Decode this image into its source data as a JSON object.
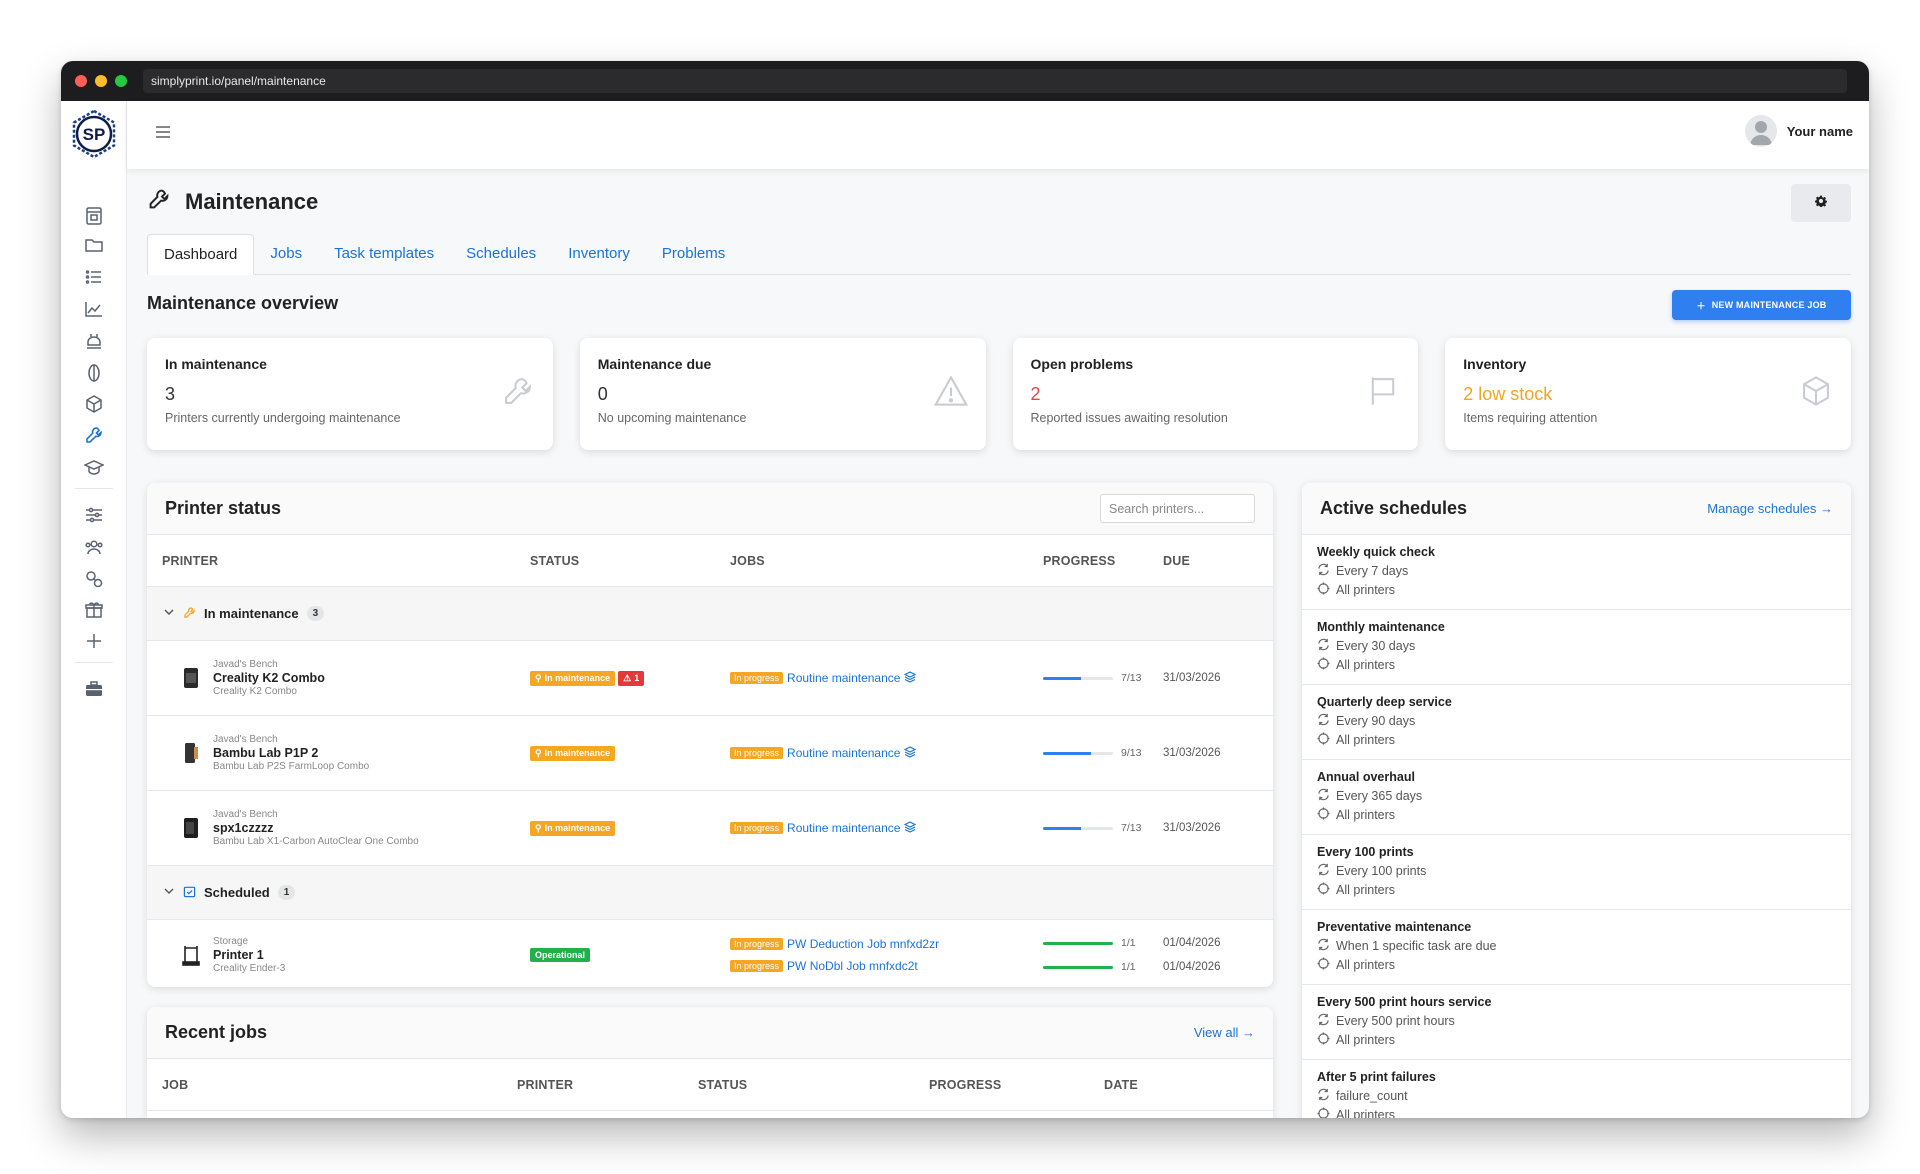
{
  "browser": {
    "url": "simplyprint.io/panel/maintenance"
  },
  "user": {
    "name": "Your name"
  },
  "page": {
    "title": "Maintenance",
    "tabs": [
      "Dashboard",
      "Jobs",
      "Task templates",
      "Schedules",
      "Inventory",
      "Problems"
    ],
    "overview_title": "Maintenance overview",
    "new_job_label": "NEW MAINTENANCE JOB"
  },
  "cards": [
    {
      "title": "In maintenance",
      "value": "3",
      "desc": "Printers currently undergoing maintenance",
      "icon": "wrench-icon"
    },
    {
      "title": "Maintenance due",
      "value": "0",
      "desc": "No upcoming maintenance",
      "icon": "warning-icon"
    },
    {
      "title": "Open problems",
      "value": "2",
      "desc": "Reported issues awaiting resolution",
      "icon": "flag-icon",
      "color": "#e0454b"
    },
    {
      "title": "Inventory",
      "value": "2 low stock",
      "desc": "Items requiring attention",
      "icon": "box-icon",
      "color": "#f0a524"
    }
  ],
  "printer_status": {
    "title": "Printer status",
    "search_placeholder": "Search printers...",
    "columns": [
      "PRINTER",
      "STATUS",
      "JOBS",
      "PROGRESS",
      "DUE"
    ],
    "groups": [
      {
        "label": "In maintenance",
        "count": "3",
        "rows": [
          {
            "location": "Javad's Bench",
            "name": "Creality K2 Combo",
            "model": "Creality K2 Combo",
            "status": "In maintenance",
            "problem_count": "1",
            "jobs": [
              {
                "state": "In progress",
                "name": "Routine maintenance",
                "progress": "7/13",
                "progress_frac": 0.54,
                "due": "31/03/2026"
              }
            ]
          },
          {
            "location": "Javad's Bench",
            "name": "Bambu Lab P1P 2",
            "model": "Bambu Lab P2S FarmLoop Combo",
            "status": "In maintenance",
            "jobs": [
              {
                "state": "In progress",
                "name": "Routine maintenance",
                "progress": "9/13",
                "progress_frac": 0.69,
                "due": "31/03/2026"
              }
            ]
          },
          {
            "location": "Javad's Bench",
            "name": "spx1czzzz",
            "model": "Bambu Lab X1-Carbon AutoClear One Combo",
            "status": "In maintenance",
            "jobs": [
              {
                "state": "In progress",
                "name": "Routine maintenance",
                "progress": "7/13",
                "progress_frac": 0.54,
                "due": "31/03/2026"
              }
            ]
          }
        ]
      },
      {
        "label": "Scheduled",
        "count": "1",
        "rows": [
          {
            "location": "Storage",
            "name": "Printer 1",
            "model": "Creality Ender-3",
            "status": "Operational",
            "jobs": [
              {
                "state": "In progress",
                "name": "PW Deduction Job mnfxd2zr",
                "progress": "1/1",
                "progress_frac": 1,
                "due": "01/04/2026"
              },
              {
                "state": "In progress",
                "name": "PW NoDbl Job mnfxdc2t",
                "progress": "1/1",
                "progress_frac": 1,
                "due": "01/04/2026"
              }
            ]
          }
        ]
      }
    ]
  },
  "recent_jobs": {
    "title": "Recent jobs",
    "view_all": "View all →",
    "columns": [
      "JOB",
      "PRINTER",
      "STATUS",
      "PROGRESS",
      "DATE"
    ]
  },
  "schedules": {
    "title": "Active schedules",
    "manage": "Manage schedules →",
    "items": [
      {
        "name": "Weekly quick check",
        "interval": "Every 7 days",
        "target": "All printers"
      },
      {
        "name": "Monthly maintenance",
        "interval": "Every 30 days",
        "target": "All printers"
      },
      {
        "name": "Quarterly deep service",
        "interval": "Every 90 days",
        "target": "All printers"
      },
      {
        "name": "Annual overhaul",
        "interval": "Every 365 days",
        "target": "All printers"
      },
      {
        "name": "Every 100 prints",
        "interval": "Every 100 prints",
        "target": "All printers"
      },
      {
        "name": "Preventative maintenance",
        "interval": "When 1 specific task are due",
        "target": "All printers"
      },
      {
        "name": "Every 500 print hours service",
        "interval": "Every 500 print hours",
        "target": "All printers"
      },
      {
        "name": "After 5 print failures",
        "interval": "failure_count",
        "target": "All printers"
      }
    ]
  },
  "colors": {
    "accent": "#1a73d9",
    "primary_button": "#2f7ff0",
    "warning": "#f5a623",
    "danger": "#e5383b",
    "success": "#22b04b"
  }
}
